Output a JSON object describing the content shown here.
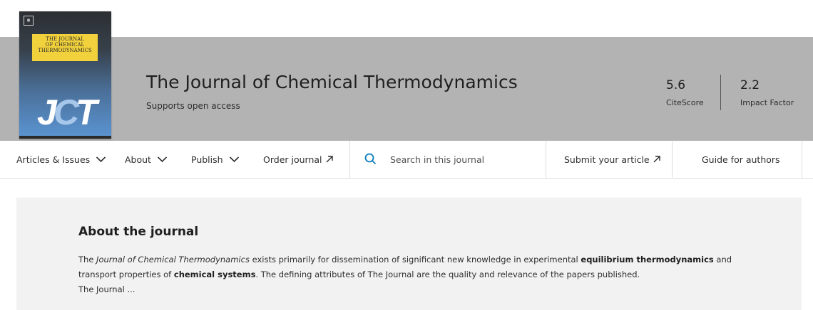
{
  "journal": {
    "title": "The Journal of Chemical Thermodynamics",
    "subtitle": "Supports open access"
  },
  "cover": {
    "publisher_logo_icon": "elsevier-logo-icon",
    "title_lines": [
      "THE JOURNAL",
      "OF CHEMICAL",
      "THERMODYNAMICS"
    ],
    "abbr_parts": [
      "J",
      "C",
      "T"
    ],
    "colors": {
      "box": "#f2d23c",
      "gradient_top": "#2c2f33",
      "gradient_bottom": "#5b95d3"
    }
  },
  "metrics": [
    {
      "value": "5.6",
      "label": "CiteScore"
    },
    {
      "value": "2.2",
      "label": "Impact Factor"
    }
  ],
  "nav": {
    "articles_issues": "Articles & Issues",
    "about": "About",
    "publish": "Publish",
    "order_journal": "Order journal",
    "search_placeholder": "Search in this journal",
    "submit_article": "Submit your article",
    "guide_for_authors": "Guide for authors",
    "icons": {
      "dropdown": "chevron-down-icon",
      "external": "external-arrow-icon",
      "search": "search-icon"
    }
  },
  "about": {
    "heading": "About the journal",
    "p1_a": "The ",
    "p1_italic": "Journal of Chemical Thermodynamics",
    "p1_b": " exists primarily for dissemination of significant new knowledge in experimental ",
    "p1_bold1": "equilibrium thermodynamics",
    "p1_c": " and transport properties of ",
    "p1_bold2": "chemical systems",
    "p1_d": ". The defining attributes of The Journal are the quality and relevance of the papers published.",
    "p2": "The Journal ..."
  },
  "colors": {
    "banner": "#b3b3b3",
    "accent": "#0c7dbb",
    "about_bg": "#f2f2f2"
  }
}
